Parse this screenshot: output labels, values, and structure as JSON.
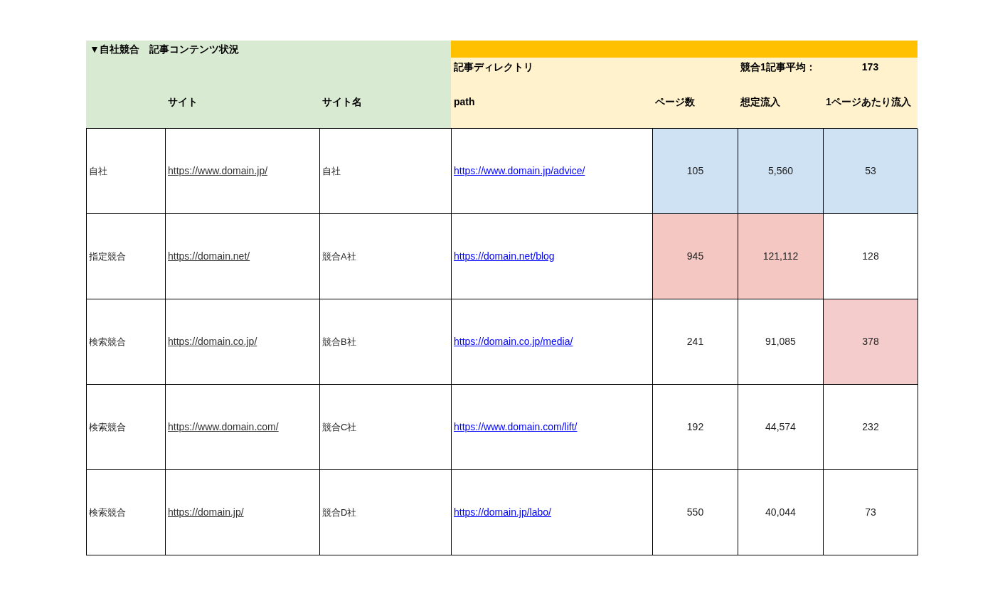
{
  "title": "▼自社競合　記事コンテンツ状況",
  "directory_label": "記事ディレクトリ",
  "average_label": "競合1記事平均：",
  "average_value": "173",
  "column_headers": [
    "サイト",
    "サイト名",
    "path",
    "ページ数",
    "想定流入",
    "1ページあたり流入"
  ],
  "rows": [
    {
      "category": "自社",
      "site": "https://www.domain.jp/",
      "site_name": "自社",
      "path": "https://www.domain.jp/advice/",
      "pages": {
        "value": "105",
        "color": "#cfe2f3"
      },
      "traffic": {
        "value": "5,560",
        "color": "#cfe2f3"
      },
      "per_page": {
        "value": "53",
        "color": "#cfe2f3"
      }
    },
    {
      "category": "指定競合",
      "site": "https://domain.net/",
      "site_name": "競合A社",
      "path": "https://domain.net/blog",
      "pages": {
        "value": "945",
        "color": "#f4c7c3"
      },
      "traffic": {
        "value": "121,112",
        "color": "#f4c7c3"
      },
      "per_page": {
        "value": "128"
      }
    },
    {
      "category": "検索競合",
      "site": "https://domain.co.jp/",
      "site_name": "競合B社",
      "path": "https://domain.co.jp/media/",
      "pages": {
        "value": "241"
      },
      "traffic": {
        "value": "91,085"
      },
      "per_page": {
        "value": "378",
        "color": "#f4cccc"
      }
    },
    {
      "category": "検索競合",
      "site": "https://www.domain.com/",
      "site_name": "競合C社",
      "path": "https://www.domain.com/lift/",
      "pages": {
        "value": "192"
      },
      "traffic": {
        "value": "44,574"
      },
      "per_page": {
        "value": "232"
      }
    },
    {
      "category": "検索競合",
      "site": "https://domain.jp/",
      "site_name": "競合D社",
      "path": "https://domain.jp/labo/",
      "pages": {
        "value": "550"
      },
      "traffic": {
        "value": "40,044"
      },
      "per_page": {
        "value": "73"
      }
    }
  ]
}
